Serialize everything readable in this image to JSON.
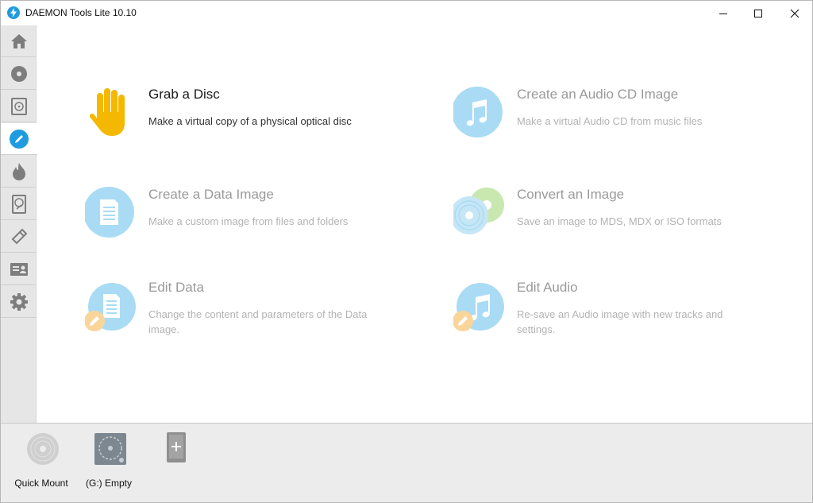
{
  "window": {
    "title": "DAEMON Tools Lite 10.10",
    "accent_color": "#1f9ce0"
  },
  "sidebar": {
    "items": [
      {
        "icon": "home-icon",
        "active": false
      },
      {
        "icon": "disc-icon",
        "active": false
      },
      {
        "icon": "image-catalog-icon",
        "active": false
      },
      {
        "icon": "pencil-icon",
        "active": true
      },
      {
        "icon": "flame-icon",
        "active": false
      },
      {
        "icon": "virtual-hdd-icon",
        "active": false
      },
      {
        "icon": "usb-icon",
        "active": false
      },
      {
        "icon": "contact-card-icon",
        "active": false
      },
      {
        "icon": "gear-icon",
        "active": false
      }
    ]
  },
  "tasks": [
    {
      "title": "Grab a Disc",
      "description": "Make a virtual copy of a physical optical disc",
      "icon": "hand-icon",
      "enabled": true
    },
    {
      "title": "Create an Audio CD Image",
      "description": "Make a virtual Audio CD from music files",
      "icon": "music-note-icon",
      "enabled": false
    },
    {
      "title": "Create a Data Image",
      "description": "Make a custom image from files and folders",
      "icon": "document-icon",
      "enabled": false
    },
    {
      "title": "Convert an Image",
      "description": "Save an image to MDS, MDX or ISO formats",
      "icon": "convert-disc-icon",
      "enabled": false
    },
    {
      "title": "Edit Data",
      "description": "Change the content and parameters of the Data image.",
      "icon": "edit-document-icon",
      "enabled": false
    },
    {
      "title": "Edit Audio",
      "description": "Re-save an Audio image with new tracks and settings.",
      "icon": "edit-music-icon",
      "enabled": false
    }
  ],
  "devices": [
    {
      "label": "Quick Mount",
      "icon": "quick-mount-disc-icon"
    },
    {
      "label": "(G:) Empty",
      "icon": "virtual-drive-icon"
    },
    {
      "label": "",
      "icon": "add-drive-icon"
    }
  ]
}
